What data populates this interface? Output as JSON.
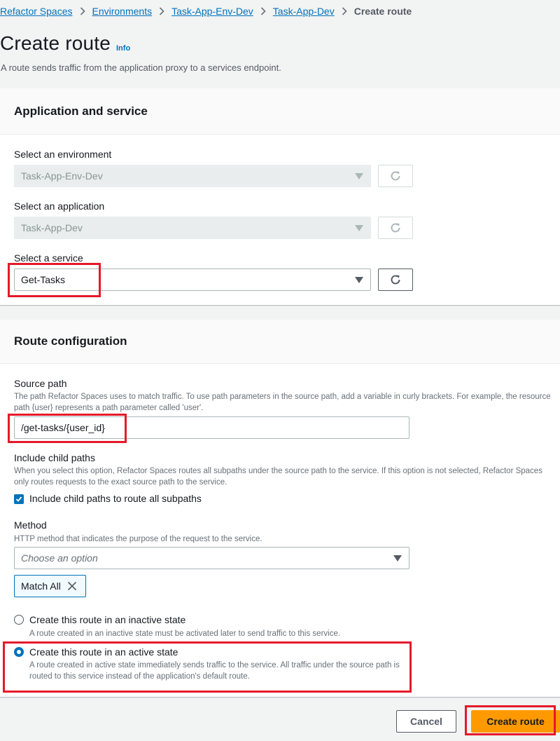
{
  "breadcrumb": {
    "items": [
      "Refactor Spaces",
      "Environments",
      "Task-App-Env-Dev",
      "Task-App-Dev"
    ],
    "current": "Create route"
  },
  "header": {
    "title": "Create route",
    "info_label": "Info",
    "description": "A route sends traffic from the application proxy to a services endpoint."
  },
  "application_section": {
    "title": "Application and service",
    "environment": {
      "label": "Select an environment",
      "value": "Task-App-Env-Dev",
      "disabled": true
    },
    "application": {
      "label": "Select an application",
      "value": "Task-App-Dev",
      "disabled": true
    },
    "service": {
      "label": "Select a service",
      "value": "Get-Tasks",
      "disabled": false
    }
  },
  "route_section": {
    "title": "Route configuration",
    "source_path": {
      "label": "Source path",
      "description": "The path Refactor Spaces uses to match traffic. To use path parameters in the source path, add a variable in curly brackets. For example, the resource path {user} represents a path parameter called 'user'.",
      "value": "/get-tasks/{user_id}"
    },
    "child_paths": {
      "label": "Include child paths",
      "description": "When you select this option, Refactor Spaces routes all subpaths under the source path to the service. If this option is not selected, Refactor Spaces only routes requests to the exact source path to the service.",
      "checkbox_label": "Include child paths to route all subpaths",
      "checked": true
    },
    "method": {
      "label": "Method",
      "description": "HTTP method that indicates the purpose of the request to the service.",
      "placeholder": "Choose an option",
      "tokens": [
        "Match All"
      ]
    },
    "state": {
      "selected": "active",
      "options": [
        {
          "id": "inactive",
          "label": "Create this route in an inactive state",
          "description": "A route created in an inactive state must be activated later to send traffic to this service."
        },
        {
          "id": "active",
          "label": "Create this route in an active state",
          "description": "A route created in active state immediately sends traffic to the service. All traffic under the source path is routed to this service instead of the application's default route."
        }
      ]
    }
  },
  "footer": {
    "cancel_label": "Cancel",
    "submit_label": "Create route"
  },
  "colors": {
    "primary": "#ff9900",
    "link": "#0073bb",
    "highlight": "#e5192b"
  }
}
